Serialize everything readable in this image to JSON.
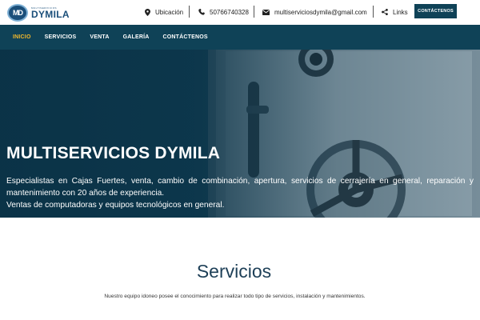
{
  "brand": {
    "logo_text": "DYMILA",
    "logo_initials": "MD",
    "logo_tagline": "MULTISERVICIOS"
  },
  "topbar": {
    "location_label": "Ubicación",
    "phone": "50766740328",
    "email": "multiserviciosdymila@gmail.com",
    "links_label": "Links",
    "contact_button": "CONTÁCTENOS",
    "icons": [
      "map-marker-icon",
      "phone-icon",
      "envelope-icon",
      "share-icon"
    ]
  },
  "nav": {
    "items": [
      {
        "label": "INICIO",
        "active": true
      },
      {
        "label": "SERVICIOS",
        "active": false
      },
      {
        "label": "VENTA",
        "active": false
      },
      {
        "label": "GALERÍA",
        "active": false
      },
      {
        "label": "CONTÁCTENOS",
        "active": false
      }
    ],
    "active_color": "#f2b92b",
    "background_color": "#0f4257"
  },
  "hero": {
    "title": "MULTISERVICIOS DYMILA",
    "description": "Especialistas en Cajas Fuertes, venta, cambio de combinación, apertura, servicios de cerrajería en general, reparación y mantenimiento con 20 años de experiencia.",
    "description2": "Ventas de computadoras y equipos tecnológicos en general."
  },
  "services": {
    "title": "Servicios",
    "subtitle": "Nuestro equipo idoneo posee el conocimiento para realizar todo tipo de servicios, instalación y mantenimientos."
  }
}
